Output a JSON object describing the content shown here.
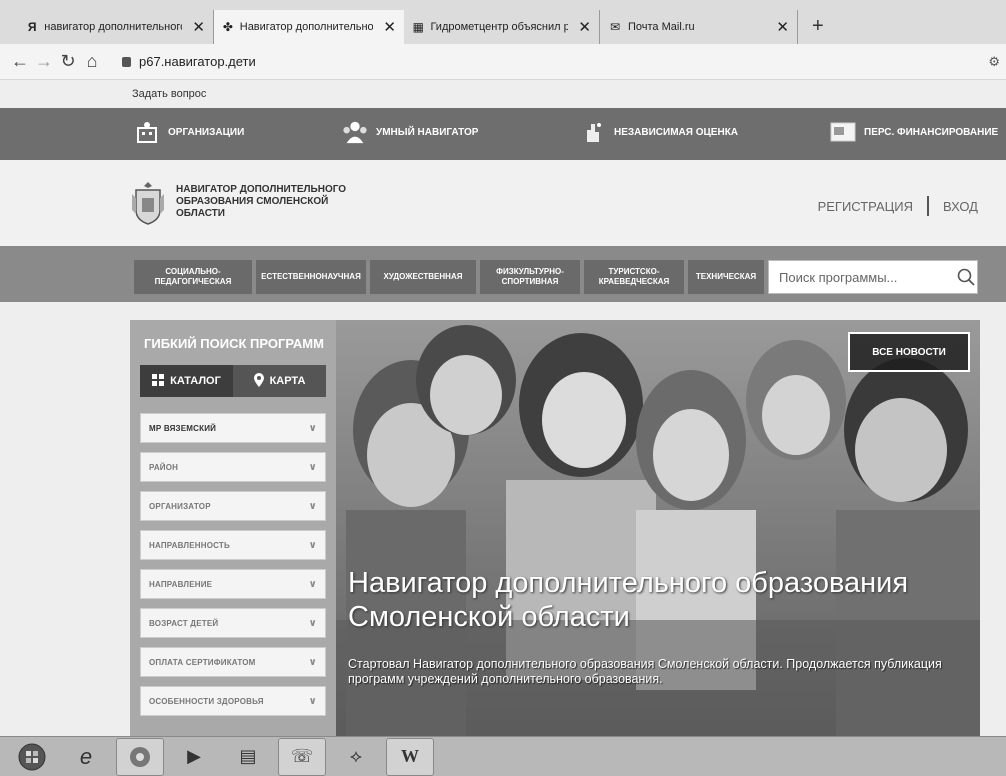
{
  "browser": {
    "tabs": [
      {
        "favicon": "Я",
        "title": "навигатор дополнительного об"
      },
      {
        "favicon": "✤",
        "title": "Навигатор дополнительного об"
      },
      {
        "favicon": "▦",
        "title": "Гидрометцентр объяснил резк"
      },
      {
        "favicon": "✉",
        "title": "Почта Mail.ru"
      }
    ],
    "close_glyph": "✕",
    "new_tab_glyph": "+",
    "url": "p67.навигатор.дети"
  },
  "page": {
    "ask_question": "Задать вопрос",
    "topnav": [
      {
        "label": "ОРГАНИЗАЦИИ",
        "icon": "building-icon"
      },
      {
        "label": "УМНЫЙ НАВИГАТОР",
        "icon": "people-icon"
      },
      {
        "label": "НЕЗАВИСИМАЯ ОЦЕНКА",
        "icon": "hand-icon"
      },
      {
        "label": "ПЕРС. ФИНАНСИРОВАНИЕ",
        "icon": "card-icon"
      }
    ],
    "site_name": "НАВИГАТОР ДОПОЛНИТЕЛЬНОГО ОБРАЗОВАНИЯ СМОЛЕНСКОЙ ОБЛАСТИ",
    "auth": {
      "register": "РЕГИСТРАЦИЯ",
      "login": "ВХОД"
    },
    "categories": [
      "СОЦИАЛЬНО-ПЕДАГОГИЧЕСКАЯ",
      "ЕСТЕСТВЕННОНАУЧНАЯ",
      "ХУДОЖЕСТВЕННАЯ",
      "ФИЗКУЛЬТУРНО-СПОРТИВНАЯ",
      "ТУРИСТСКО-КРАЕВЕДЧЕСКАЯ",
      "ТЕХНИЧЕСКАЯ"
    ],
    "search_placeholder": "Поиск программы...",
    "sidebar": {
      "title": "ГИБКИЙ ПОИСК ПРОГРАММ",
      "catalog": "КАТАЛОГ",
      "map": "КАРТА",
      "filters": [
        "МР ВЯЗЕМСКИЙ",
        "РАЙОН",
        "ОРГАНИЗАТОР",
        "НАПРАВЛЕННОСТЬ",
        "НАПРАВЛЕНИЕ",
        "ВОЗРАСТ ДЕТЕЙ",
        "ОПЛАТА СЕРТИФИКАТОМ",
        "ОСОБЕННОСТИ ЗДОРОВЬЯ"
      ]
    },
    "hero": {
      "news_button": "ВСЕ НОВОСТИ",
      "title": "Навигатор дополнительного образования Смоленской области",
      "text": "Стартовал Навигатор дополнительного образования Смоленской области. Продолжается публикация программ учреждений дополнительного образования."
    }
  },
  "taskbar": [
    "start-orb-icon",
    "ie-icon",
    "chrome-icon",
    "media-player-icon",
    "printer-icon",
    "viber-icon",
    "pdf-icon",
    "word-icon"
  ]
}
